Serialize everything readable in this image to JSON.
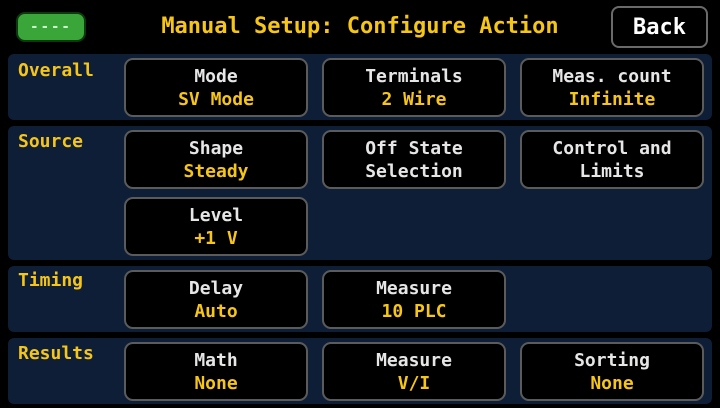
{
  "header": {
    "title": "Manual Setup:  Configure Action",
    "back_label": "Back",
    "usb_indicator": "----"
  },
  "colors": {
    "accent": "#f5c518",
    "panel": "#0e1e36",
    "usb": "#3aa63a"
  },
  "sections": {
    "overall": {
      "label": "Overall",
      "mode": {
        "label": "Mode",
        "value": "SV Mode"
      },
      "terminals": {
        "label": "Terminals",
        "value": "2 Wire"
      },
      "meas_count": {
        "label": "Meas. count",
        "value": "Infinite"
      }
    },
    "source": {
      "label": "Source",
      "shape": {
        "label": "Shape",
        "value": "Steady"
      },
      "off_state": {
        "line1": "Off State",
        "line2": "Selection"
      },
      "control": {
        "line1": "Control and",
        "line2": "Limits"
      },
      "level": {
        "label": "Level",
        "value": "+1 V"
      }
    },
    "timing": {
      "label": "Timing",
      "delay": {
        "label": "Delay",
        "value": "Auto"
      },
      "measure": {
        "label": "Measure",
        "value": "10 PLC"
      }
    },
    "results": {
      "label": "Results",
      "math": {
        "label": "Math",
        "value": "None"
      },
      "measure": {
        "label": "Measure",
        "value": "V/I"
      },
      "sorting": {
        "label": "Sorting",
        "value": "None"
      }
    }
  }
}
